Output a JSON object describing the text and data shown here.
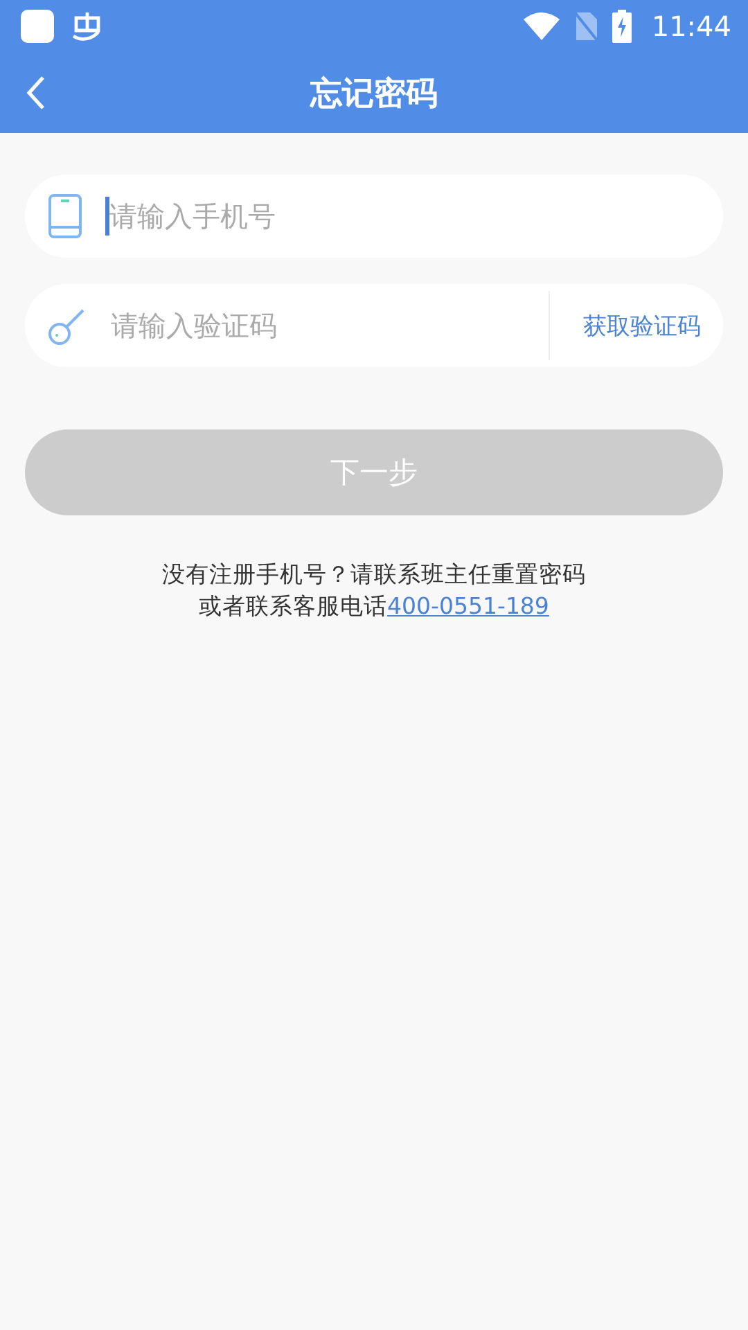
{
  "status_bar": {
    "time": "11:44"
  },
  "header": {
    "title": "忘记密码"
  },
  "phone_field": {
    "placeholder": "请输入手机号",
    "focused": true
  },
  "code_field": {
    "placeholder": "请输入验证码",
    "action": "获取验证码"
  },
  "next_button": {
    "label": "下一步",
    "disabled": true
  },
  "help": {
    "line_1": "没有注册手机号？请联系班主任重置密码",
    "line_2": "或者联系客服电话",
    "link": "400-0551-189"
  }
}
